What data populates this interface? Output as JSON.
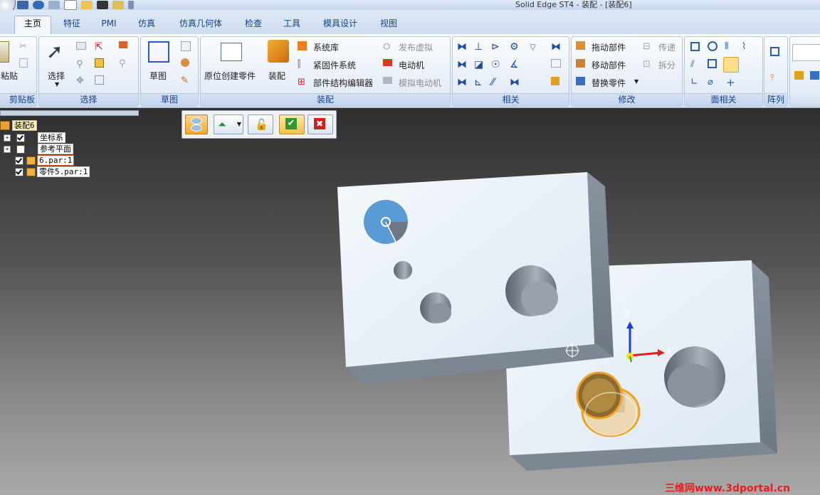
{
  "window": {
    "title": "Solid Edge ST4 - 装配 - [装配6]"
  },
  "tabs": [
    "主页",
    "特征",
    "PMI",
    "仿真",
    "仿真几何体",
    "检查",
    "工具",
    "模具设计",
    "视图"
  ],
  "ribbon": {
    "clipboard": {
      "label": "剪贴板",
      "paste": "粘贴"
    },
    "select": {
      "label": "选择",
      "select": "选择"
    },
    "sketch": {
      "label": "草图",
      "sketch": "草图"
    },
    "assemble": {
      "label": "装配",
      "create_in_place": "原位创建零件",
      "assemble": "装配",
      "system_library": "系统库",
      "fastener_system": "紧固件系统",
      "structure_editor": "部件结构编辑器",
      "publish_virtual": "发布虚拟",
      "motor": "电动机",
      "simulate_motor": "模拟电动机"
    },
    "relate": {
      "label": "相关"
    },
    "modify": {
      "label": "修改",
      "drag_component": "拖动部件",
      "move_component": "移动部件",
      "replace_part": "替换零件",
      "transfer": "传递",
      "disperse": "拆分"
    },
    "face_relate": {
      "label": "面相关"
    },
    "pattern": {
      "label": "阵列"
    }
  },
  "pathfinder": {
    "root": "装配6",
    "items": [
      {
        "label": "坐标系",
        "checked": true,
        "expandable": true
      },
      {
        "label": "参考平面",
        "checked": false,
        "expandable": true
      },
      {
        "label": "6.par:1",
        "checked": true,
        "expandable": false
      },
      {
        "label": "零件5.par:1",
        "checked": true,
        "expandable": false
      }
    ]
  },
  "triad": {
    "z": "Z",
    "x": "X"
  },
  "watermark": "三维网www.3dportal.cn",
  "colors": {
    "accent": "#15428b",
    "watermark": "#e81e1e",
    "highlight_face": "#5b9bd5",
    "selected_edge": "#f0a020"
  }
}
